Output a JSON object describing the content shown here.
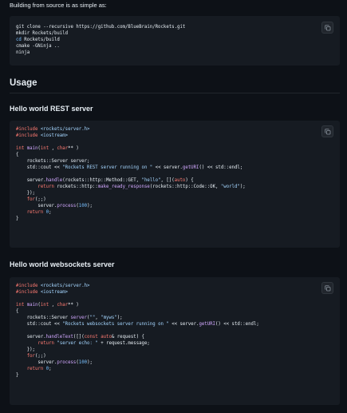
{
  "intro_text": "Building from source is as simple as:",
  "build_block": {
    "lines": [
      [
        {
          "t": "git clone --recursive https://github.com/BlueBrain/Rockets.git",
          "c": "plain"
        }
      ],
      [
        {
          "t": "mkdir Rockets/build",
          "c": "plain"
        }
      ],
      [
        {
          "t": "cd",
          "c": "num"
        },
        {
          "t": " Rockets/build",
          "c": "plain"
        }
      ],
      [
        {
          "t": "cmake -GNinja ..",
          "c": "plain"
        }
      ],
      [
        {
          "t": "ninja",
          "c": "plain"
        }
      ]
    ]
  },
  "usage_heading": "Usage",
  "rest_heading": "Hello world REST server",
  "rest_block": {
    "lines": [
      [
        {
          "t": "#include",
          "c": "kw"
        },
        {
          "t": " <rockets/server.h>",
          "c": "str"
        }
      ],
      [
        {
          "t": "#include",
          "c": "kw"
        },
        {
          "t": " <iostream>",
          "c": "str"
        }
      ],
      [],
      [
        {
          "t": "int",
          "c": "kw"
        },
        {
          "t": " ",
          "c": "plain"
        },
        {
          "t": "main",
          "c": "fn"
        },
        {
          "t": "(",
          "c": "plain"
        },
        {
          "t": "int",
          "c": "kw"
        },
        {
          "t": " , ",
          "c": "plain"
        },
        {
          "t": "char",
          "c": "kw"
        },
        {
          "t": "** )",
          "c": "plain"
        }
      ],
      [
        {
          "t": "{",
          "c": "plain"
        }
      ],
      [
        {
          "t": "    rockets::Server server;",
          "c": "plain"
        }
      ],
      [
        {
          "t": "    std::cout << ",
          "c": "plain"
        },
        {
          "t": "\"Rockets REST server running on \"",
          "c": "str"
        },
        {
          "t": " << server.",
          "c": "plain"
        },
        {
          "t": "getURI",
          "c": "fn"
        },
        {
          "t": "() << std::endl;",
          "c": "plain"
        }
      ],
      [],
      [
        {
          "t": "    server.",
          "c": "plain"
        },
        {
          "t": "handle",
          "c": "fn"
        },
        {
          "t": "(rockets::http::Method::GET, ",
          "c": "plain"
        },
        {
          "t": "\"hello\"",
          "c": "str"
        },
        {
          "t": ", [](",
          "c": "plain"
        },
        {
          "t": "auto",
          "c": "kw"
        },
        {
          "t": ") {",
          "c": "plain"
        }
      ],
      [
        {
          "t": "        ",
          "c": "plain"
        },
        {
          "t": "return",
          "c": "kw"
        },
        {
          "t": " rockets::http::",
          "c": "plain"
        },
        {
          "t": "make_ready_response",
          "c": "fn"
        },
        {
          "t": "(rockets::http::Code::OK, ",
          "c": "plain"
        },
        {
          "t": "\"world\"",
          "c": "str"
        },
        {
          "t": ");",
          "c": "plain"
        }
      ],
      [
        {
          "t": "    });",
          "c": "plain"
        }
      ],
      [
        {
          "t": "    ",
          "c": "plain"
        },
        {
          "t": "for",
          "c": "kw"
        },
        {
          "t": "(;;)",
          "c": "plain"
        }
      ],
      [
        {
          "t": "        server.",
          "c": "plain"
        },
        {
          "t": "process",
          "c": "fn"
        },
        {
          "t": "(",
          "c": "plain"
        },
        {
          "t": "100",
          "c": "num"
        },
        {
          "t": ");",
          "c": "plain"
        }
      ],
      [
        {
          "t": "    ",
          "c": "plain"
        },
        {
          "t": "return",
          "c": "kw"
        },
        {
          "t": " ",
          "c": "plain"
        },
        {
          "t": "0",
          "c": "num"
        },
        {
          "t": ";",
          "c": "plain"
        }
      ],
      [
        {
          "t": "}",
          "c": "plain"
        }
      ]
    ]
  },
  "ws_heading": "Hello world websockets server",
  "ws_block": {
    "lines": [
      [
        {
          "t": "#include",
          "c": "kw"
        },
        {
          "t": " <rockets/server.h>",
          "c": "str"
        }
      ],
      [
        {
          "t": "#include",
          "c": "kw"
        },
        {
          "t": " <iostream>",
          "c": "str"
        }
      ],
      [],
      [
        {
          "t": "int",
          "c": "kw"
        },
        {
          "t": " ",
          "c": "plain"
        },
        {
          "t": "main",
          "c": "fn"
        },
        {
          "t": "(",
          "c": "plain"
        },
        {
          "t": "int",
          "c": "kw"
        },
        {
          "t": " , ",
          "c": "plain"
        },
        {
          "t": "char",
          "c": "kw"
        },
        {
          "t": "** )",
          "c": "plain"
        }
      ],
      [
        {
          "t": "{",
          "c": "plain"
        }
      ],
      [
        {
          "t": "    rockets::Server ",
          "c": "plain"
        },
        {
          "t": "server",
          "c": "fn"
        },
        {
          "t": "(",
          "c": "plain"
        },
        {
          "t": "\"\"",
          "c": "str"
        },
        {
          "t": ", ",
          "c": "plain"
        },
        {
          "t": "\"myws\"",
          "c": "str"
        },
        {
          "t": ");",
          "c": "plain"
        }
      ],
      [
        {
          "t": "    std::cout << ",
          "c": "plain"
        },
        {
          "t": "\"Rockets websockets server running on \"",
          "c": "str"
        },
        {
          "t": " << server.",
          "c": "plain"
        },
        {
          "t": "getURI",
          "c": "fn"
        },
        {
          "t": "() << std::endl;",
          "c": "plain"
        }
      ],
      [],
      [
        {
          "t": "    server.",
          "c": "plain"
        },
        {
          "t": "handleText",
          "c": "fn"
        },
        {
          "t": "([](",
          "c": "plain"
        },
        {
          "t": "const",
          "c": "kw"
        },
        {
          "t": " ",
          "c": "plain"
        },
        {
          "t": "auto",
          "c": "kw"
        },
        {
          "t": "& request) {",
          "c": "plain"
        }
      ],
      [
        {
          "t": "        ",
          "c": "plain"
        },
        {
          "t": "return",
          "c": "kw"
        },
        {
          "t": " ",
          "c": "plain"
        },
        {
          "t": "\"server echo: \"",
          "c": "str"
        },
        {
          "t": " + request.message;",
          "c": "plain"
        }
      ],
      [
        {
          "t": "    });",
          "c": "plain"
        }
      ],
      [
        {
          "t": "    ",
          "c": "plain"
        },
        {
          "t": "for",
          "c": "kw"
        },
        {
          "t": "(;;)",
          "c": "plain"
        }
      ],
      [
        {
          "t": "        server.",
          "c": "plain"
        },
        {
          "t": "process",
          "c": "fn"
        },
        {
          "t": "(",
          "c": "plain"
        },
        {
          "t": "100",
          "c": "num"
        },
        {
          "t": ");",
          "c": "plain"
        }
      ],
      [
        {
          "t": "    ",
          "c": "plain"
        },
        {
          "t": "return",
          "c": "kw"
        },
        {
          "t": " ",
          "c": "plain"
        },
        {
          "t": "0",
          "c": "num"
        },
        {
          "t": ";",
          "c": "plain"
        }
      ],
      [
        {
          "t": "}",
          "c": "plain"
        }
      ]
    ]
  },
  "colors": {
    "background": "#0d1117",
    "code_background": "#161b22",
    "keyword": "#ff7b72",
    "string": "#a5d6ff",
    "function": "#d2a8ff",
    "constant": "#79c0ff",
    "text": "#e6edf3"
  },
  "icons": {
    "copy": "copy-icon"
  }
}
